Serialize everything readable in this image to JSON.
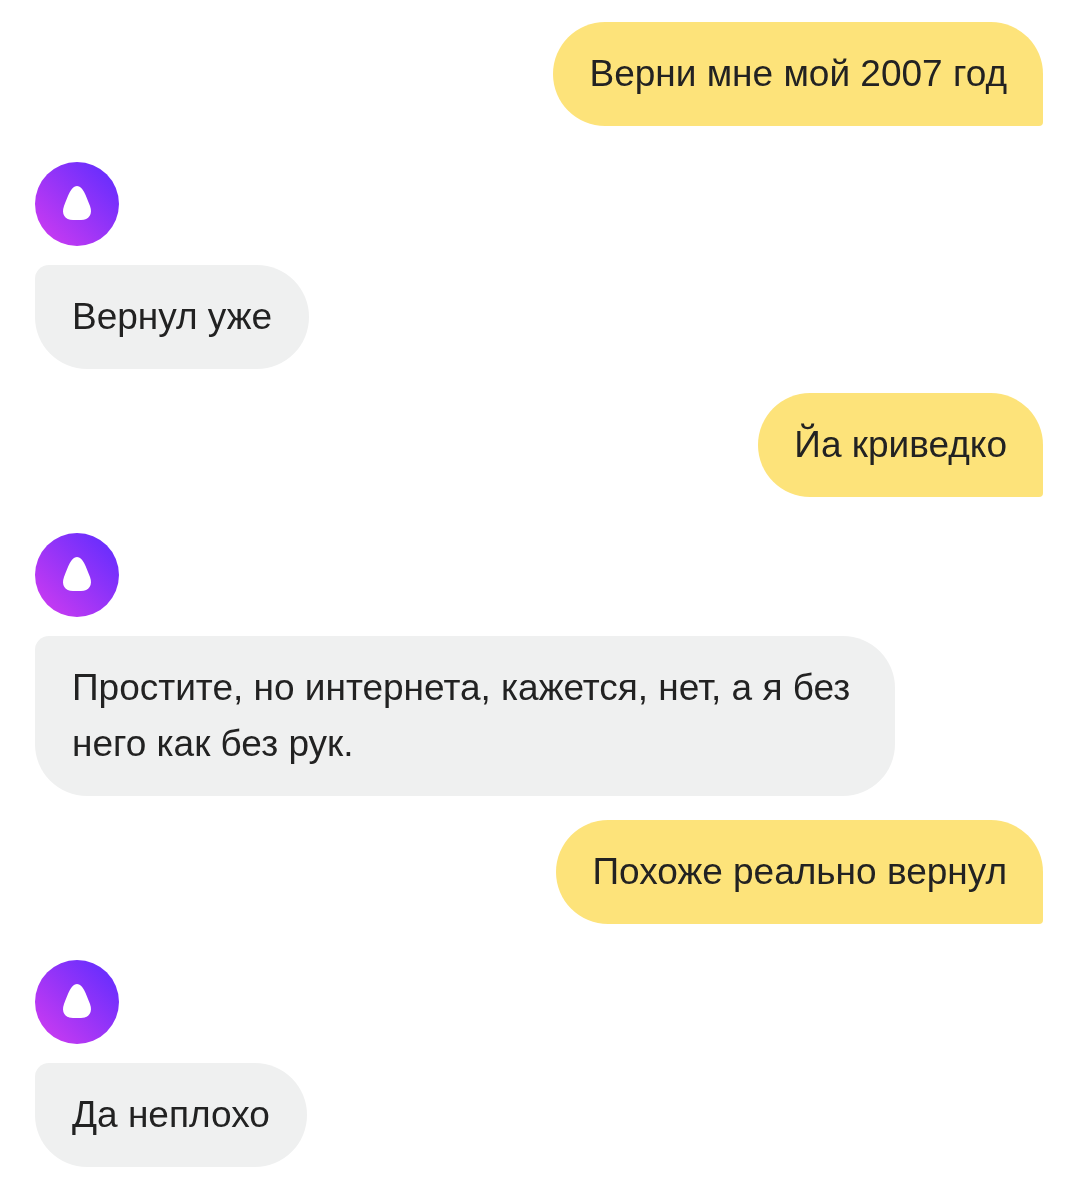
{
  "messages": [
    {
      "kind": "user",
      "text": "Верни мне мой 2007 год"
    },
    {
      "kind": "assistant",
      "text": "Вернул уже"
    },
    {
      "kind": "user",
      "text": "Йа криведко"
    },
    {
      "kind": "assistant",
      "text": "Простите, но интернета, кажется, нет, а я без него как без рук."
    },
    {
      "kind": "user",
      "text": "Похоже реально вернул"
    },
    {
      "kind": "assistant",
      "text": "Да неплохо"
    }
  ]
}
